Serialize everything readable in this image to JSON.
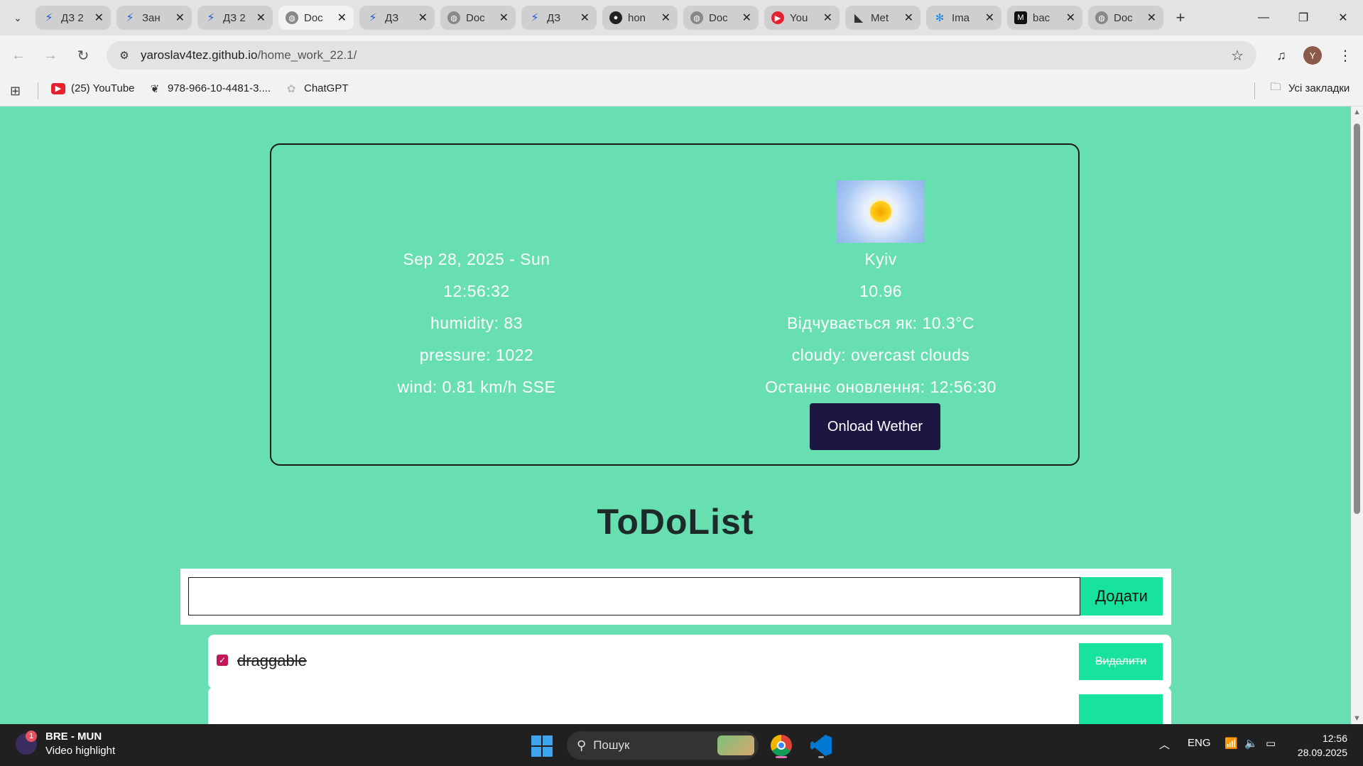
{
  "browser": {
    "tabs": [
      {
        "title": "ДЗ 2",
        "icon": "sprint-icon",
        "active": false
      },
      {
        "title": "Зан",
        "icon": "sprint-icon",
        "active": false
      },
      {
        "title": "ДЗ 2",
        "icon": "sprint-icon",
        "active": false
      },
      {
        "title": "Doc",
        "icon": "globe-icon",
        "active": true
      },
      {
        "title": "ДЗ",
        "icon": "sprint-icon",
        "active": false
      },
      {
        "title": "Doc",
        "icon": "globe-icon",
        "active": false
      },
      {
        "title": "ДЗ",
        "icon": "sprint-icon",
        "active": false
      },
      {
        "title": "hon",
        "icon": "github-icon",
        "active": false
      },
      {
        "title": "Doc",
        "icon": "globe-icon",
        "active": false
      },
      {
        "title": "You",
        "icon": "youtube-icon",
        "active": false
      },
      {
        "title": "Met",
        "icon": "meteo-icon",
        "active": false
      },
      {
        "title": "Ima",
        "icon": "image-icon",
        "active": false
      },
      {
        "title": "bac",
        "icon": "m-icon",
        "active": false
      },
      {
        "title": "Doc",
        "icon": "globe-icon",
        "active": false
      }
    ],
    "url": {
      "host": "yaroslav4tez.github.io",
      "path": "/home_work_22.1/"
    },
    "profile_initial": "Y",
    "bookmarks": [
      {
        "label": "(25) YouTube",
        "icon": "youtube-icon"
      },
      {
        "label": "978-966-10-4481-3....",
        "icon": "book-icon"
      },
      {
        "label": "ChatGPT",
        "icon": "chatgpt-icon"
      }
    ],
    "all_bookmarks_label": "Усі закладки"
  },
  "weather": {
    "date": "Sep 28, 2025 - Sun",
    "time": "12:56:32",
    "humidity": "humidity: 83",
    "pressure": "pressure: 1022",
    "wind": "wind: 0.81 km/h SSE",
    "city": "Kyiv",
    "temp": "10.96",
    "feels_like": "Відчувається як: 10.3°C",
    "description": "cloudy: overcast clouds",
    "last_update": "Останнє оновлення: 12:56:30",
    "button_label": "Onload Wether"
  },
  "todo": {
    "title": "ToDoList",
    "input_value": "",
    "add_label": "Додати",
    "items": [
      {
        "text": "draggable",
        "done": true,
        "delete_label": "Видалити"
      }
    ]
  },
  "taskbar": {
    "widget_title": "BRE - MUN",
    "widget_subtitle": "Video highlight",
    "widget_badge": "1",
    "search_label": "Пошук",
    "language": "ENG",
    "time": "12:56",
    "date": "28.09.2025"
  },
  "colors": {
    "page_bg": "#67dfb1",
    "accent_button": "#18e39c",
    "weather_button": "#1b1642"
  }
}
